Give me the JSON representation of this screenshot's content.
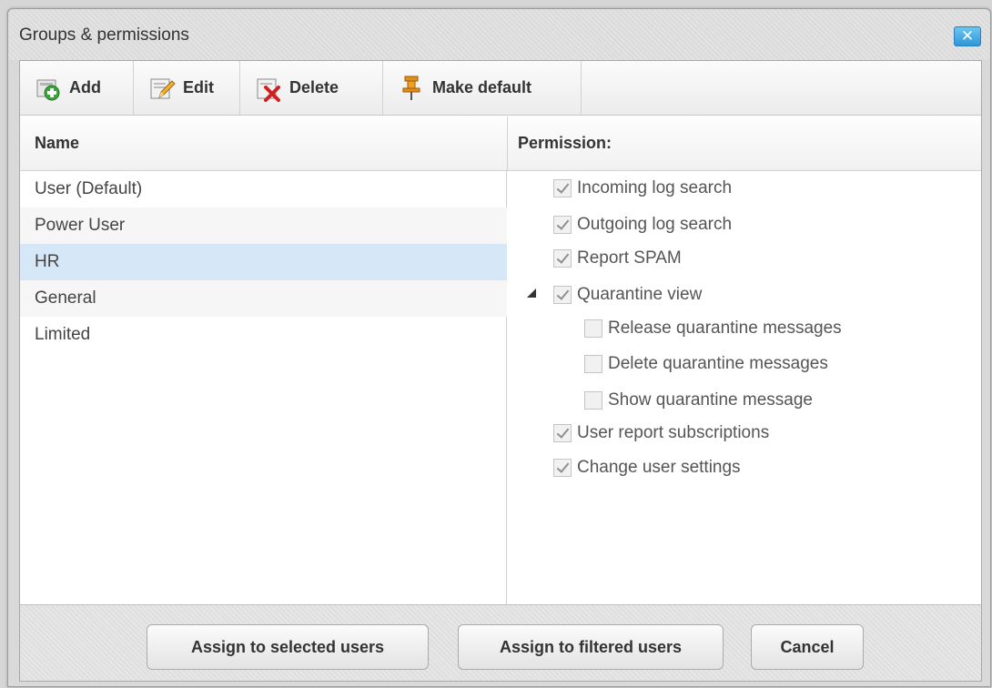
{
  "dialog": {
    "title": "Groups & permissions",
    "close_label": "✕"
  },
  "toolbar": {
    "add_label": "Add",
    "edit_label": "Edit",
    "delete_label": "Delete",
    "make_default_label": "Make default"
  },
  "columns": {
    "name": "Name",
    "permission": "Permission:"
  },
  "groups": [
    {
      "label": "User (Default)",
      "selected": false
    },
    {
      "label": "Power User",
      "selected": false
    },
    {
      "label": "HR",
      "selected": true
    },
    {
      "label": "General",
      "selected": false
    },
    {
      "label": "Limited",
      "selected": false
    }
  ],
  "permissions": [
    {
      "label": "Incoming log search",
      "checked": true
    },
    {
      "label": "Outgoing log search",
      "checked": true
    },
    {
      "label": "Report SPAM",
      "checked": true
    },
    {
      "label": "Quarantine view",
      "checked": true,
      "expanded": true
    },
    {
      "label": "Release quarantine messages",
      "checked": false
    },
    {
      "label": "Delete quarantine messages",
      "checked": false
    },
    {
      "label": "Show quarantine message",
      "checked": false
    },
    {
      "label": "User report subscriptions",
      "checked": true
    },
    {
      "label": "Change user settings",
      "checked": true
    }
  ],
  "footer": {
    "assign_selected_label": "Assign to selected users",
    "assign_filtered_label": "Assign to filtered users",
    "cancel_label": "Cancel"
  },
  "icons": {
    "add": "add-icon",
    "edit": "edit-icon",
    "delete": "delete-icon",
    "make_default": "pin-icon"
  },
  "colors": {
    "selection": "#d6e8f8",
    "close_button": "#2e97d8",
    "checkbox_disabled": "#f1f1f1"
  }
}
